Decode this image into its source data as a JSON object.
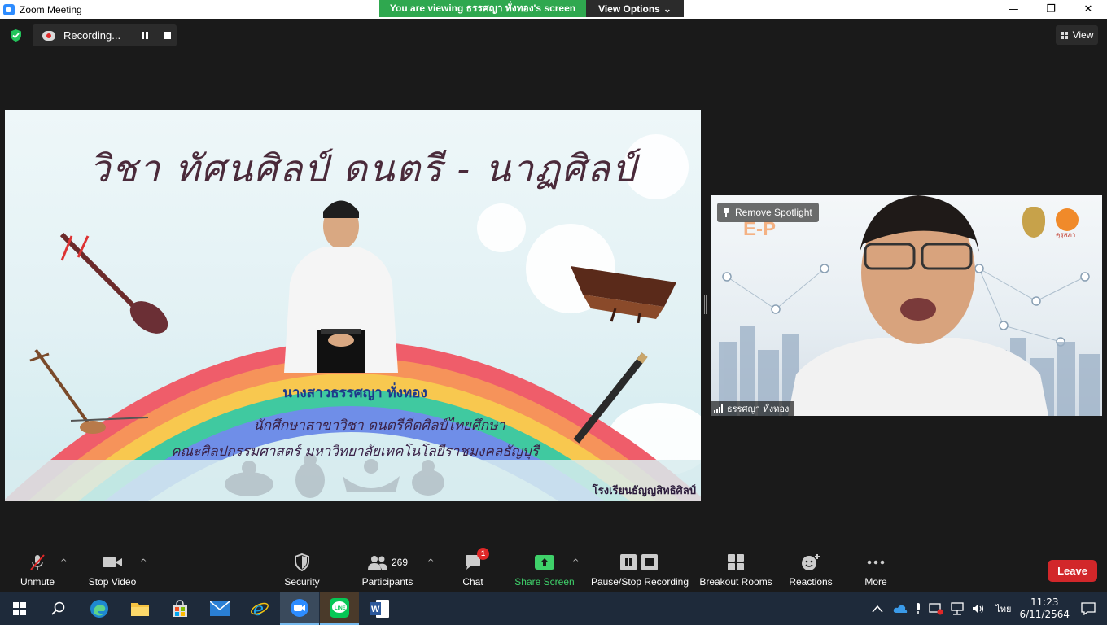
{
  "window": {
    "title": "Zoom Meeting",
    "minimize": "—",
    "maximize": "❐",
    "close": "✕"
  },
  "banner": {
    "viewing_text": "You are viewing ธรรศญา ทั่งทอง's screen",
    "view_options_label": "View Options",
    "view_options_caret": "⌄"
  },
  "recording": {
    "label": "Recording..."
  },
  "view_button": {
    "label": "View"
  },
  "shared_slide": {
    "title": "วิชา ทัศนศิลป์ ดนตรี - นาฏศิลป์",
    "name": "นางสาวธรรศญา ทั่งทอง",
    "department": "นักศึกษาสาขาวิชา ดนตรีคีตศิลป์ไทยศึกษา",
    "faculty": "คณะศิลปกรรมศาสตร์ มหาวิทยาลัยเทคโนโลยีราชมงคลธัญบุรี",
    "school": "โรงเรียนธัญญสิทธิศิลป์"
  },
  "video_tile": {
    "remove_spotlight": "Remove Spotlight",
    "participant_name": "ธรรศญา ทั่งทอง",
    "background_text": "E-P",
    "logo_caption": "คุรุสภา"
  },
  "toolbar": {
    "unmute": "Unmute",
    "stop_video": "Stop Video",
    "security": "Security",
    "participants": "Participants",
    "participants_count": "269",
    "chat": "Chat",
    "chat_badge": "1",
    "share_screen": "Share Screen",
    "pause_stop_recording": "Pause/Stop Recording",
    "breakout_rooms": "Breakout Rooms",
    "reactions": "Reactions",
    "more": "More",
    "leave": "Leave",
    "caret": "^"
  },
  "taskbar": {
    "language": "ไทย",
    "time": "11:23",
    "date": "6/11/2564"
  },
  "colors": {
    "accent_green": "#2fa84f",
    "leave_red": "#d2272a",
    "share_green": "#3fd16a",
    "dark_bg": "#1a1a1a"
  }
}
